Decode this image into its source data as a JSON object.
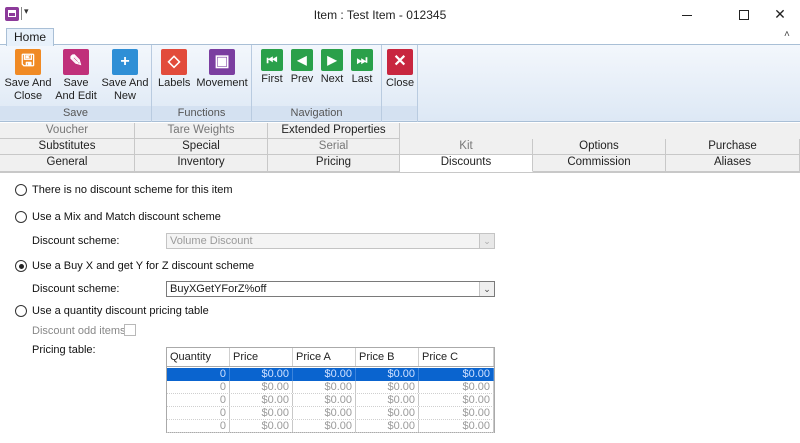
{
  "window": {
    "title": "Item : Test Item - 012345",
    "qat_arrow": "▾",
    "minimize_icon": "minimize-icon",
    "maximize_icon": "maximize-icon",
    "close_glyph": "✕"
  },
  "ribbon": {
    "home_tab": "Home",
    "collapse_glyph": "˄",
    "groups": {
      "save": {
        "label": "Save",
        "save_and_close": [
          "Save And",
          "Close"
        ],
        "save_and_edit": [
          "Save",
          "And Edit"
        ],
        "save_and_new": [
          "Save And",
          "New"
        ]
      },
      "functions": {
        "label": "Functions",
        "labels": "Labels",
        "movement": "Movement"
      },
      "navigation": {
        "label": "Navigation",
        "first": "First",
        "prev": "Prev",
        "next": "Next",
        "last": "Last"
      },
      "close": {
        "label": "Close"
      }
    },
    "colors": {
      "save_close": "#f08a24",
      "save_edit": "#c0307a",
      "save_new": "#2f8fd6",
      "labels": "#e24b3b",
      "movement": "#7b3ea0",
      "navigation": "#2aa04a",
      "close": "#c8263f"
    }
  },
  "tabs": {
    "row1": [
      "Voucher",
      "Tare Weights",
      "Extended Properties"
    ],
    "row2": [
      "Substitutes",
      "Special",
      "Serial",
      "Kit",
      "Options",
      "Purchase"
    ],
    "row3": [
      "General",
      "Inventory",
      "Pricing",
      "Discounts",
      "Commission",
      "Aliases"
    ],
    "active": "Discounts"
  },
  "discounts": {
    "opt_none": "There is no discount scheme for this item",
    "opt_mix": "Use a Mix and Match discount scheme",
    "mix_scheme_label": "Discount scheme:",
    "mix_scheme_value": "Volume Discount",
    "opt_buyx": "Use a Buy X and get Y for Z discount scheme",
    "buyx_scheme_label": "Discount scheme:",
    "buyx_scheme_value": "BuyXGetYForZ%off",
    "opt_qty": "Use a quantity discount pricing table",
    "odd_items_label": "Discount odd items:",
    "pricing_table_label": "Pricing table:",
    "selected_option": "buyx"
  },
  "pricing_table": {
    "columns": [
      "Quantity",
      "Price",
      "Price A",
      "Price B",
      "Price C"
    ],
    "rows": [
      [
        "0",
        "$0.00",
        "$0.00",
        "$0.00",
        "$0.00"
      ],
      [
        "0",
        "$0.00",
        "$0.00",
        "$0.00",
        "$0.00"
      ],
      [
        "0",
        "$0.00",
        "$0.00",
        "$0.00",
        "$0.00"
      ],
      [
        "0",
        "$0.00",
        "$0.00",
        "$0.00",
        "$0.00"
      ],
      [
        "0",
        "$0.00",
        "$0.00",
        "$0.00",
        "$0.00"
      ]
    ],
    "selected_row": 0
  }
}
